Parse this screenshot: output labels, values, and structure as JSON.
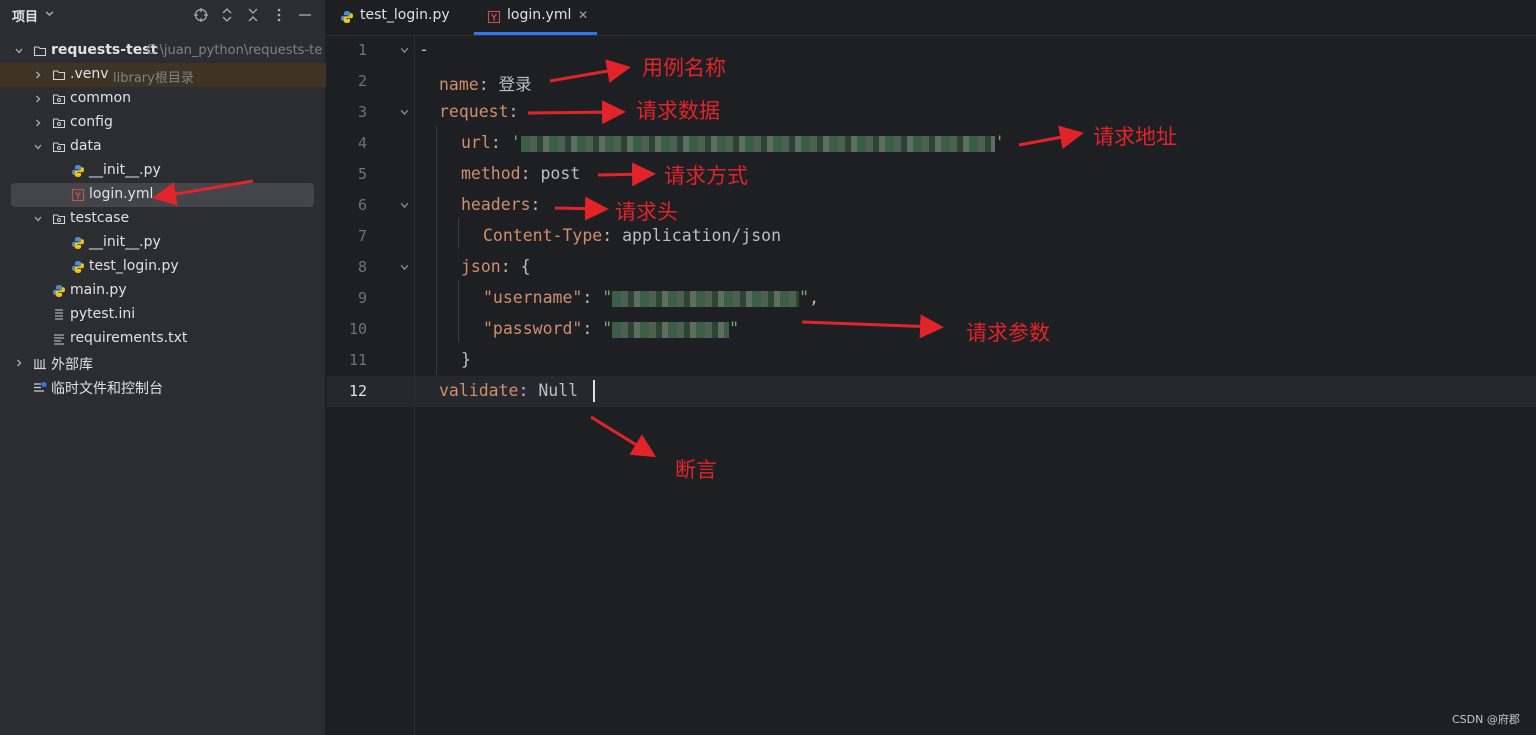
{
  "project_panel": {
    "title": "项目",
    "tree": [
      {
        "label": "requests-test",
        "hint": "C:\\juan_python\\requests-te"
      },
      {
        "label": ".venv",
        "hint": "library根目录"
      },
      {
        "label": "common"
      },
      {
        "label": "config"
      },
      {
        "label": "data"
      },
      {
        "label": "__init__.py"
      },
      {
        "label": "login.yml"
      },
      {
        "label": "testcase"
      },
      {
        "label": "__init__.py"
      },
      {
        "label": "test_login.py"
      },
      {
        "label": "main.py"
      },
      {
        "label": "pytest.ini"
      },
      {
        "label": "requirements.txt"
      },
      {
        "label": "外部库"
      },
      {
        "label": "临时文件和控制台"
      }
    ]
  },
  "tabs": [
    {
      "label": "test_login.py",
      "active": false
    },
    {
      "label": "login.yml",
      "active": true
    }
  ],
  "editor": {
    "current_line": 12,
    "line_numbers": [
      "1",
      "2",
      "3",
      "4",
      "5",
      "6",
      "7",
      "8",
      "9",
      "10",
      "11",
      "12"
    ],
    "lines": {
      "l1": "-",
      "l2_key": "name",
      "l2_val": "登录",
      "l3_key": "request",
      "l4_key": "url",
      "l4_quote_open": "'",
      "l4_quote_close": "'",
      "l5_key": "method",
      "l5_val": "post",
      "l6_key": "headers",
      "l7_key": "Content-Type",
      "l7_val": "application/json",
      "l8_key": "json",
      "l8_val": "{",
      "l9_key": "\"username\"",
      "l9_open": "\"",
      "l9_close": "\"",
      "l10_key": "\"password\"",
      "l10_open": "\"",
      "l10_close": "\"",
      "l11": "}",
      "l12_key": "validate",
      "l12_val": "Null"
    }
  },
  "annotations": {
    "case_name": "用例名称",
    "request_data": "请求数据",
    "request_url": "请求地址",
    "request_method": "请求方式",
    "request_headers": "请求头",
    "request_params": "请求参数",
    "assertion": "断言"
  },
  "watermark": "CSDN @府郡",
  "colors": {
    "accent": "#3574f0",
    "annotation": "#e0242a",
    "yaml_key": "#cf8e6d",
    "string": "#6aab73"
  }
}
